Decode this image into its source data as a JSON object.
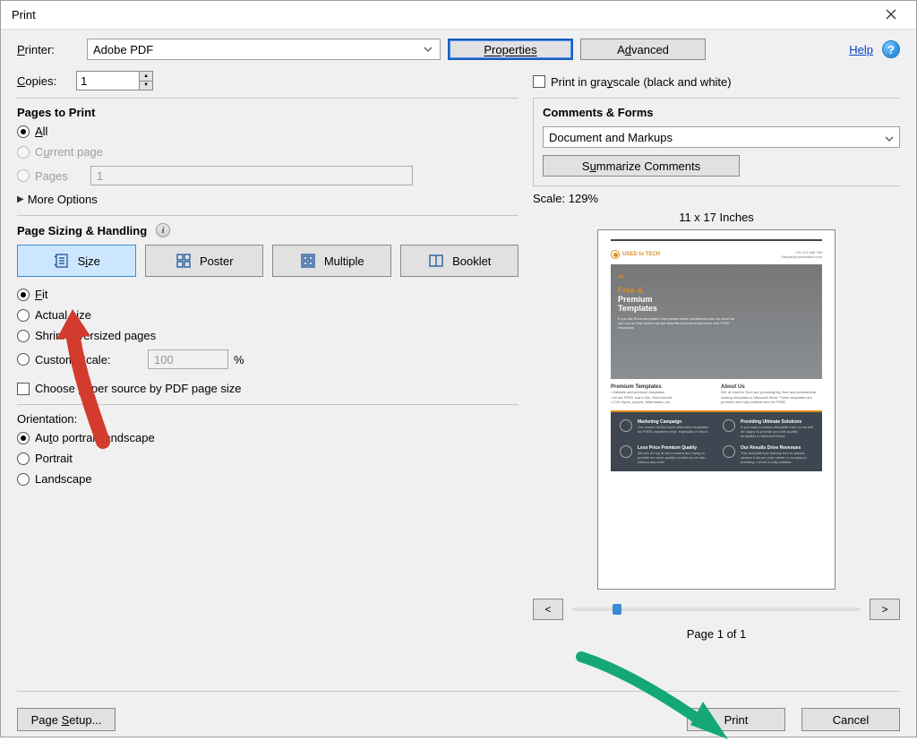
{
  "window": {
    "title": "Print"
  },
  "toolbar": {
    "printer_label": "Printer:",
    "printer_value": "Adobe PDF",
    "properties": "Properties",
    "advanced": "Advanced",
    "help": "Help",
    "copies_label": "Copies:",
    "copies_value": "1",
    "grayscale": "Print in grayscale (black and white)"
  },
  "pages": {
    "title": "Pages to Print",
    "all": "All",
    "current": "Current page",
    "pages_label": "Pages",
    "pages_value": "1",
    "more": "More Options"
  },
  "sizing": {
    "title": "Page Sizing & Handling",
    "size": "Size",
    "poster": "Poster",
    "multiple": "Multiple",
    "booklet": "Booklet",
    "fit": "Fit",
    "actual": "Actual size",
    "shrink": "Shrink oversized pages",
    "custom": "Custom Scale:",
    "custom_value": "100",
    "percent": "%",
    "choose_source": "Choose paper source by PDF page size"
  },
  "orientation": {
    "title": "Orientation:",
    "auto": "Auto portrait/landscape",
    "portrait": "Portrait",
    "landscape": "Landscape"
  },
  "comments": {
    "title": "Comments & Forms",
    "value": "Document and Markups",
    "summarize": "Summarize Comments"
  },
  "preview": {
    "scale": "Scale: 129%",
    "dimensions": "11 x 17 Inches",
    "prev": "<",
    "next": ">",
    "page_indicator": "Page 1 of 1",
    "doc": {
      "brand": "USED to TECH",
      "hero_line1": "Free &",
      "hero_line2": "Premium",
      "hero_line3": "Templates",
      "col1_title": "Premium Templates",
      "col2_title": "About Us",
      "chip1": "Marketing Campaign",
      "chip2": "Providing Ultimate Solutions",
      "chip3": "Less Price Premium Quality",
      "chip4": "Our Results Drive Revenues"
    }
  },
  "footer": {
    "page_setup": "Page Setup...",
    "print": "Print",
    "cancel": "Cancel"
  }
}
